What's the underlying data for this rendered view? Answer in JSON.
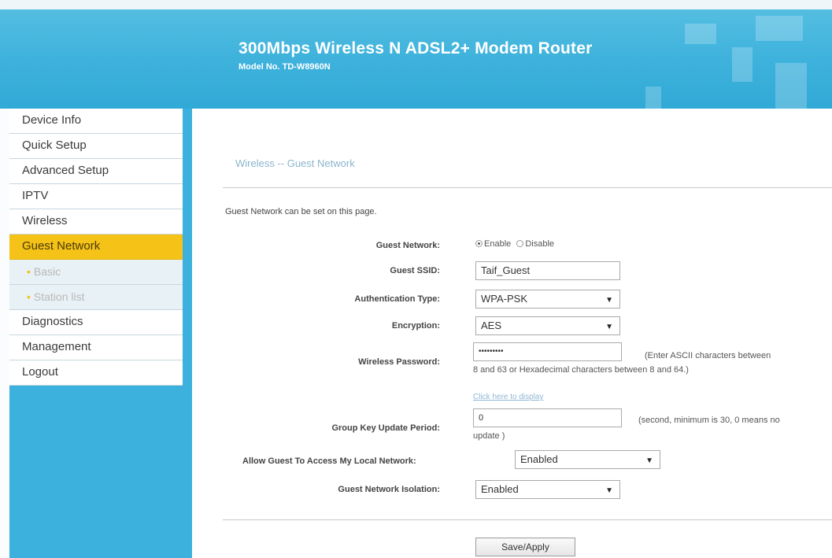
{
  "header": {
    "title": "300Mbps Wireless N ADSL2+ Modem Router",
    "model": "Model No. TD-W8960N"
  },
  "sidebar": {
    "items": [
      {
        "label": "Device Info"
      },
      {
        "label": "Quick Setup"
      },
      {
        "label": "Advanced Setup"
      },
      {
        "label": "IPTV"
      },
      {
        "label": "Wireless"
      },
      {
        "label": "Guest Network"
      },
      {
        "label": "Basic"
      },
      {
        "label": "Station list"
      },
      {
        "label": "Diagnostics"
      },
      {
        "label": "Management"
      },
      {
        "label": "Logout"
      }
    ],
    "active": "Guest Network"
  },
  "main": {
    "page_title": "Wireless -- Guest Network",
    "description": "Guest Network can be set on this page.",
    "guest_network": {
      "label": "Guest Network:",
      "enable": "Enable",
      "disable": "Disable",
      "selected": "Enable"
    },
    "guest_ssid": {
      "label": "Guest SSID:",
      "value": "Taif_Guest"
    },
    "auth_type": {
      "label": "Authentication Type:",
      "value": "WPA-PSK"
    },
    "encryption": {
      "label": "Encryption:",
      "value": "AES"
    },
    "password": {
      "label": "Wireless Password:",
      "value": "•••••••••",
      "hint_line1": "(Enter ASCII characters between",
      "hint_line2": "8 and 63 or Hexadecimal characters between 8 and 64.)",
      "display_link": "Click here to display"
    },
    "group_key": {
      "label": "Group Key Update Period:",
      "value": "0",
      "hint_line1": "(second, minimum is 30, 0 means no",
      "hint_line2": "update )"
    },
    "local_access": {
      "label": "Allow Guest To Access My Local Network:",
      "value": "Enabled"
    },
    "isolation": {
      "label": "Guest Network Isolation:",
      "value": "Enabled"
    },
    "save_button": "Save/Apply"
  },
  "colors": {
    "header_bg": "#3eb2dc",
    "active_menu": "#f5c218",
    "sidebar_bg": "#3cb1dd"
  }
}
